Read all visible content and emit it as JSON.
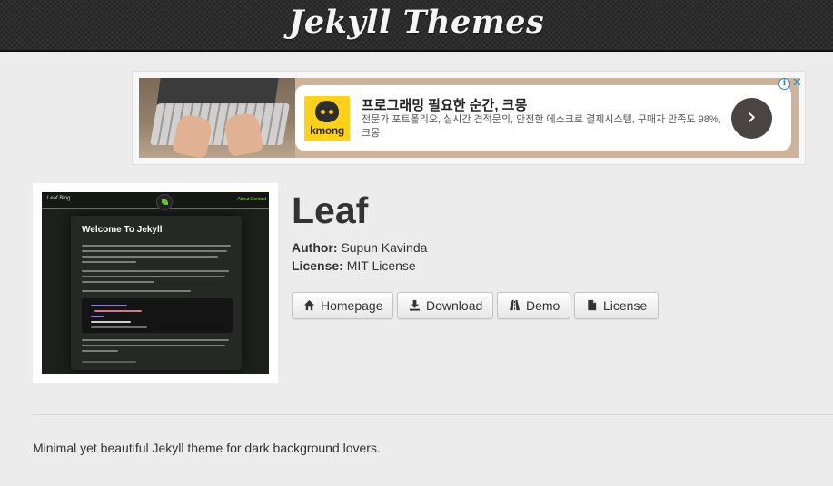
{
  "header": {
    "title": "Jekyll Themes"
  },
  "ad": {
    "brand": "kmong",
    "headline": "프로그래밍 필요한 순간, 크몽",
    "description": "전문가 포트폴리오, 실시간 견적문의, 안전한 에스크로 결제시스템, 구매자 만족도 98%, 크몽",
    "cta_icon": "chevron-right-icon",
    "info_icon": "adchoices-info-icon",
    "info_symbol": "i",
    "close_symbol": "✕",
    "cta_symbol": "›"
  },
  "theme_preview": {
    "brand": "Leaf Blog",
    "nav_links": "About    Contact",
    "post_title": "Welcome To Jekyll",
    "accent_color": "#6ec23a"
  },
  "theme": {
    "name": "Leaf",
    "author_label": "Author:",
    "author": "Supun Kavinda",
    "license_label": "License:",
    "license": "MIT License",
    "description": "Minimal yet beautiful Jekyll theme for dark background lovers."
  },
  "actions": {
    "homepage": {
      "label": "Homepage",
      "icon": "home-icon"
    },
    "download": {
      "label": "Download",
      "icon": "download-icon"
    },
    "demo": {
      "label": "Demo",
      "icon": "road-icon"
    },
    "license": {
      "label": "License",
      "icon": "document-icon"
    }
  }
}
